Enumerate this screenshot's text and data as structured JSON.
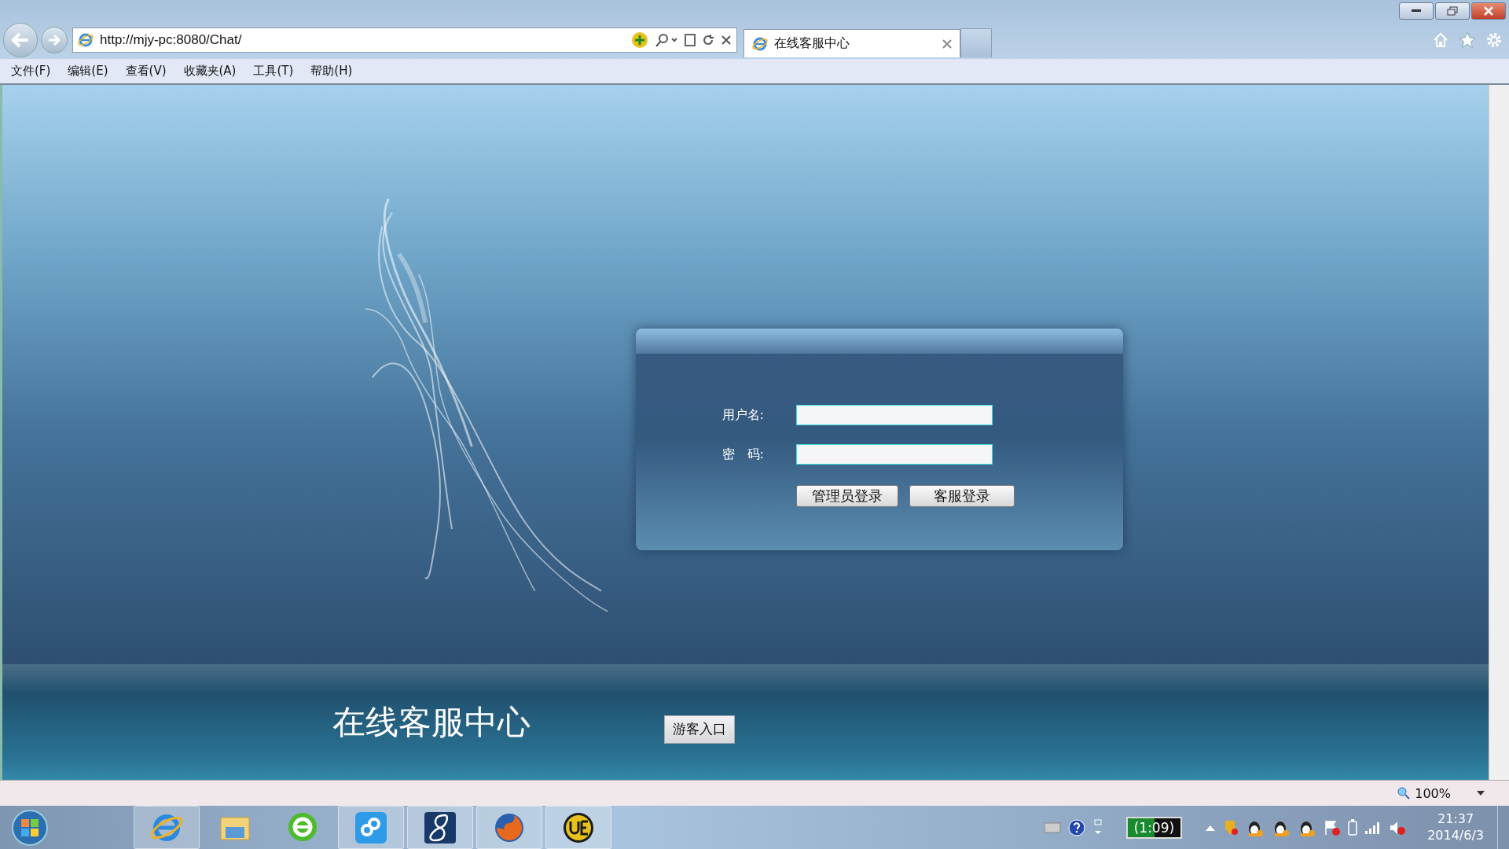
{
  "browser": {
    "address": "http://mjy-pc:8080/Chat/",
    "tabs": [
      {
        "title": "在线客服中心",
        "selected": true
      }
    ],
    "menu": [
      "文件(F)",
      "编辑(E)",
      "查看(V)",
      "收藏夹(A)",
      "工具(T)",
      "帮助(H)"
    ]
  },
  "login": {
    "fields": [
      {
        "label": "用户名:"
      },
      {
        "label": "密　码:"
      }
    ],
    "buttons": [
      "管理员登录",
      "客服登录"
    ]
  },
  "footer": {
    "title": "在线客服中心",
    "guest_button": "游客入口"
  },
  "status_bar": {
    "zoom": "100%"
  },
  "taskbar": {
    "apps": [
      {
        "kind": "ie",
        "selected": true
      },
      {
        "kind": "folder",
        "selected": false
      },
      {
        "kind": "green-e",
        "selected": false
      },
      {
        "kind": "cloud",
        "selected": true
      },
      {
        "kind": "eight",
        "selected": true
      },
      {
        "kind": "firefox",
        "selected": true
      },
      {
        "kind": "ue",
        "selected": true
      }
    ],
    "battery": "(1:09)",
    "time": "21:37",
    "date": "2014/6/3"
  }
}
